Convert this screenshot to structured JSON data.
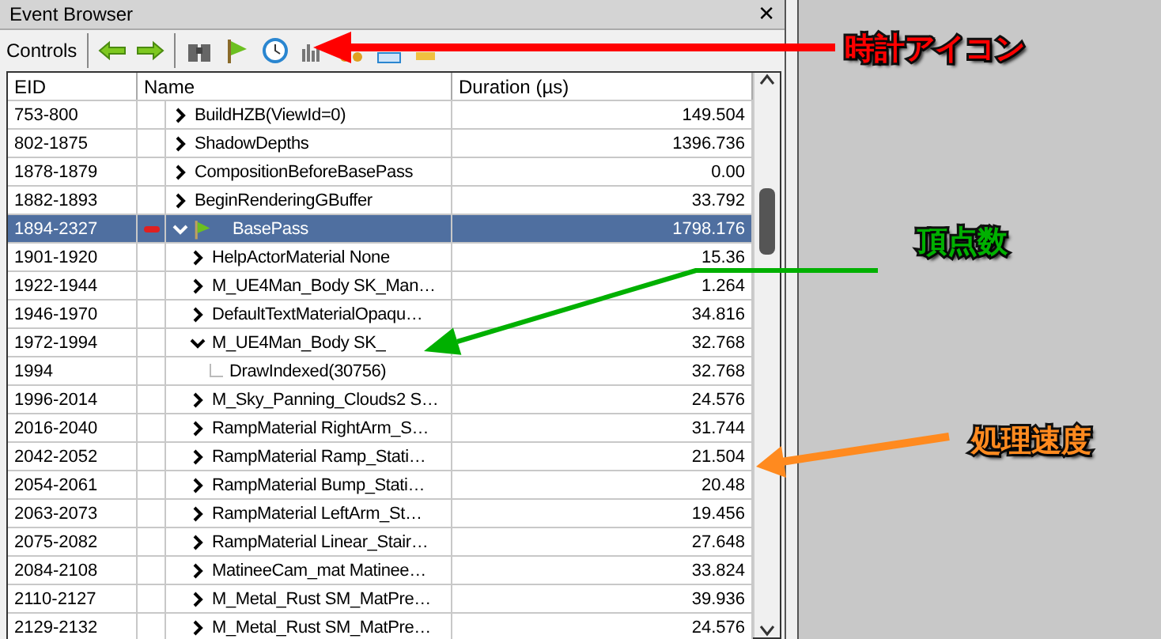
{
  "window": {
    "title": "Event Browser",
    "close": "✕"
  },
  "toolbar": {
    "label": "Controls"
  },
  "table": {
    "columns": [
      "EID",
      "Name",
      "Duration (µs)"
    ],
    "rows": [
      {
        "eid": "753-800",
        "name": "BuildHZB(ViewId=0)",
        "duration": "149.504",
        "selected": false,
        "flagged": false,
        "expanded": false
      },
      {
        "eid": "802-1875",
        "name": "ShadowDepths",
        "duration": "1396.736",
        "selected": false,
        "flagged": false,
        "expanded": false
      },
      {
        "eid": "1878-1879",
        "name": "CompositionBeforeBasePass",
        "duration": "0.00",
        "selected": false,
        "flagged": false,
        "expanded": false
      },
      {
        "eid": "1882-1893",
        "name": "BeginRenderingGBuffer",
        "duration": "33.792",
        "selected": false,
        "flagged": false,
        "expanded": false
      },
      {
        "eid": "1894-2327",
        "name": "BasePass",
        "duration": "1798.176",
        "selected": true,
        "flagged": true,
        "expanded": true,
        "children": [
          {
            "eid": "1901-1920",
            "name": "HelpActorMaterial None",
            "duration": "15.36",
            "selected": false,
            "flagged": false,
            "expanded": false
          },
          {
            "eid": "1922-1944",
            "name": "M_UE4Man_Body SK_Man…",
            "duration": "1.264",
            "selected": false,
            "flagged": false,
            "expanded": false
          },
          {
            "eid": "1946-1970",
            "name": "DefaultTextMaterialOpaqu…",
            "duration": "34.816",
            "selected": false,
            "flagged": false,
            "expanded": false
          },
          {
            "eid": "1972-1994",
            "name": "M_UE4Man_Body SK_",
            "duration": "32.768",
            "selected": false,
            "flagged": false,
            "expanded": true,
            "children": [
              {
                "eid": "1994",
                "name": "DrawIndexed(30756)",
                "duration": "32.768",
                "selected": false,
                "flagged": false
              }
            ]
          },
          {
            "eid": "1996-2014",
            "name": "M_Sky_Panning_Clouds2 S…",
            "duration": "24.576",
            "selected": false,
            "flagged": false,
            "expanded": false
          },
          {
            "eid": "2016-2040",
            "name": "RampMaterial RightArm_S…",
            "duration": "31.744",
            "selected": false,
            "flagged": false,
            "expanded": false
          },
          {
            "eid": "2042-2052",
            "name": "RampMaterial Ramp_Stati…",
            "duration": "21.504",
            "selected": false,
            "flagged": false,
            "expanded": false
          },
          {
            "eid": "2054-2061",
            "name": "RampMaterial Bump_Stati…",
            "duration": "20.48",
            "selected": false,
            "flagged": false,
            "expanded": false
          },
          {
            "eid": "2063-2073",
            "name": "RampMaterial LeftArm_St…",
            "duration": "19.456",
            "selected": false,
            "flagged": false,
            "expanded": false
          },
          {
            "eid": "2075-2082",
            "name": "RampMaterial Linear_Stair…",
            "duration": "27.648",
            "selected": false,
            "flagged": false,
            "expanded": false
          },
          {
            "eid": "2084-2108",
            "name": "MatineeCam_mat Matinee…",
            "duration": "33.824",
            "selected": false,
            "flagged": false,
            "expanded": false
          },
          {
            "eid": "2110-2127",
            "name": "M_Metal_Rust SM_MatPre…",
            "duration": "39.936",
            "selected": false,
            "flagged": false,
            "expanded": false
          },
          {
            "eid": "2129-2132",
            "name": "M_Metal_Rust SM_MatPre…",
            "duration": "24.576",
            "selected": false,
            "flagged": false,
            "expanded": false
          }
        ]
      }
    ]
  },
  "annotations": [
    {
      "text": "時計アイコン",
      "color": "#ff0000"
    },
    {
      "text": "頂点数",
      "color": "#00b000"
    },
    {
      "text": "処理速度",
      "color": "#ff8a1f"
    }
  ]
}
